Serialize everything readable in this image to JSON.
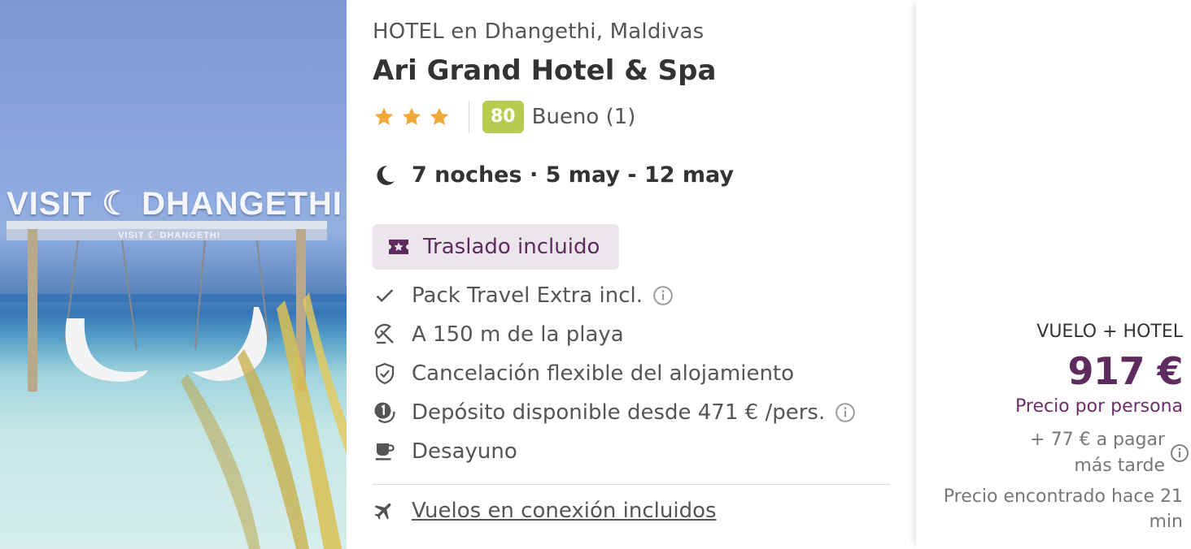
{
  "image": {
    "alt_sign_text": "VISIT ☾ DHANGETHI",
    "sub_sign_text": "VISIT ☾ DHANGETHI"
  },
  "hotel": {
    "location": "HOTEL en Dhangethi, Maldivas",
    "name": "Ari Grand Hotel & Spa",
    "stars": 3,
    "score": "80",
    "score_label": "Bueno (1)",
    "score_color": "#b7cc4f"
  },
  "stay": {
    "dates": "7 noches · 5 may - 12 may",
    "icon": "moon-icon"
  },
  "transfer": {
    "label": "Traslado incluido",
    "icon": "ticket-star-icon",
    "bg_color": "#ece6ec",
    "text_color": "#5f2b5e"
  },
  "features": [
    {
      "label": "Pack Travel Extra incl.",
      "icon": "check-icon",
      "info": true
    },
    {
      "label": "A 150 m de la playa",
      "icon": "beach-umbrella-icon",
      "info": false
    },
    {
      "label": "Cancelación flexible del alojamiento",
      "icon": "shield-check-icon",
      "info": false
    },
    {
      "label": "Depósito disponible desde 471 € /pers.",
      "icon": "deposit-icon",
      "info": true
    },
    {
      "label": "Desayuno",
      "icon": "coffee-cup-icon",
      "info": false
    }
  ],
  "flights": {
    "label": "Vuelos en conexión incluidos",
    "icon": "plane-icon"
  },
  "price": {
    "package_label": "VUELO + HOTEL",
    "amount": "917 €",
    "per_person": "Precio por persona",
    "extra": "+ 77 € a pagar más tarde",
    "found": "Precio encontrado hace 21 min",
    "accent_color": "#5f2b5e"
  }
}
